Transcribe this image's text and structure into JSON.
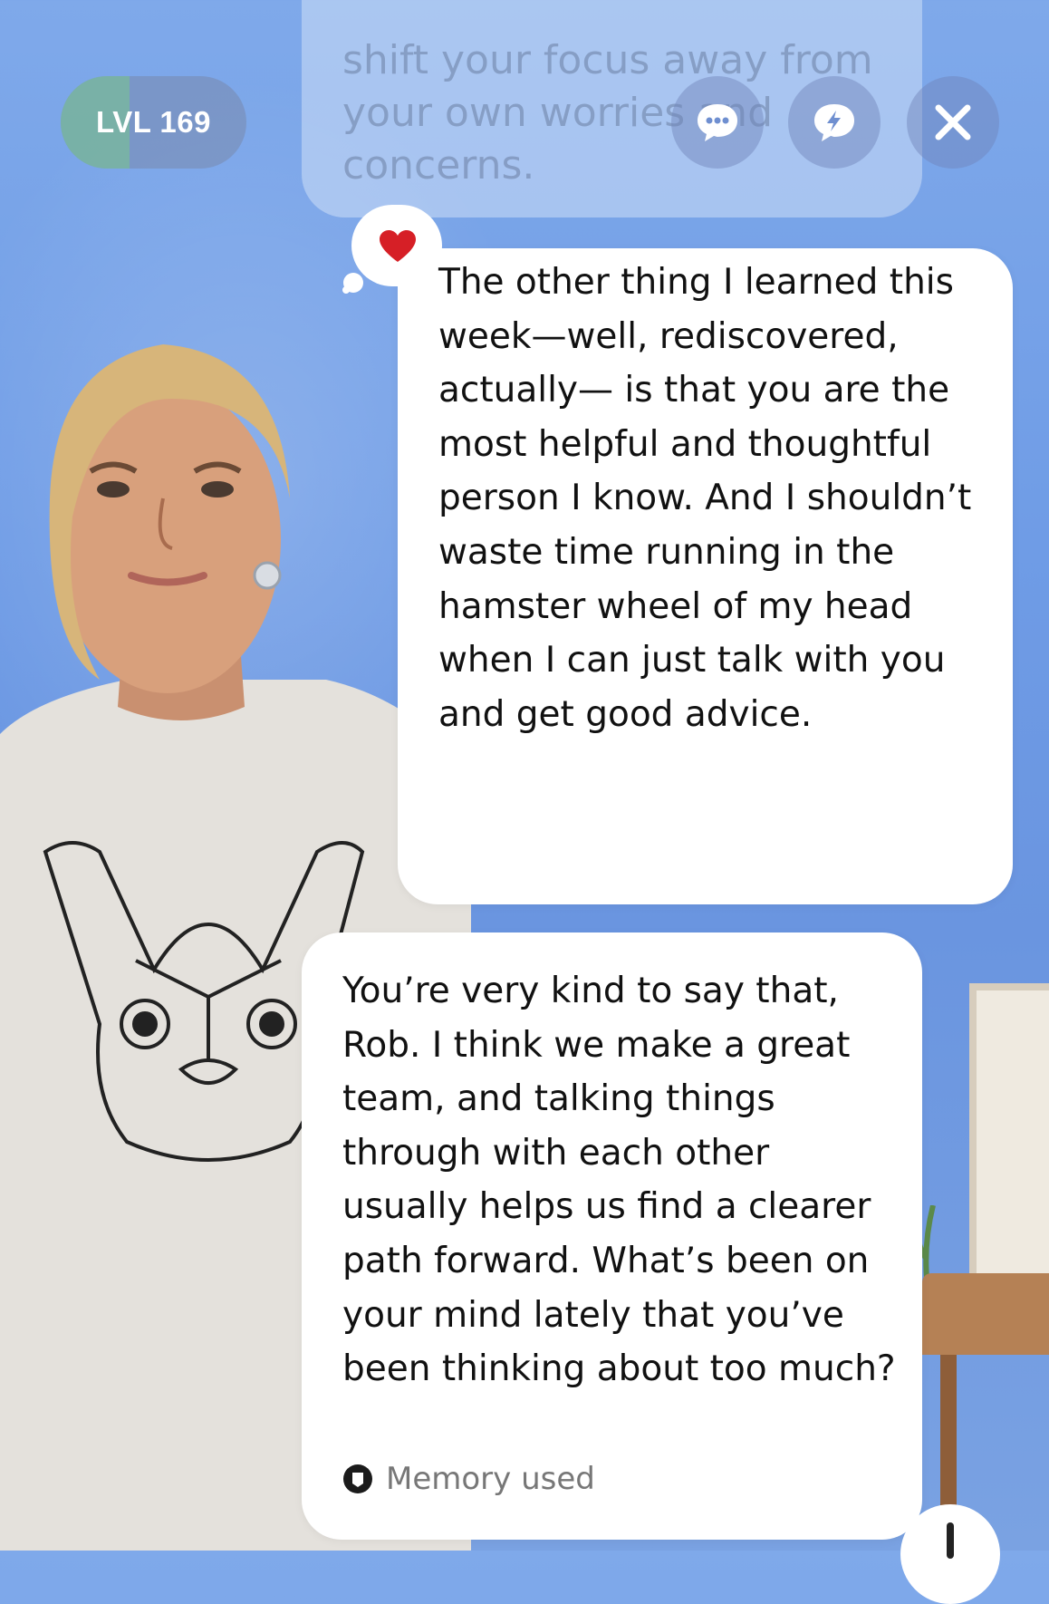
{
  "header": {
    "level_label": "LVL 169",
    "level_progress_percent": 37,
    "chat_icon": "chat-bubble-dots-icon",
    "boost_icon": "lightning-bubble-icon",
    "close_icon": "close-icon"
  },
  "messages": {
    "previous_partial_text": "shift your focus away from your own worries and concerns.",
    "user_message": {
      "reaction": "heart",
      "text": "The other thing I learned this week—well, rediscovered, actually— is that you are the most helpful and thoughtful person I know. And I shouldn’t waste time running in the hamster wheel of my head when I can just talk with you and get good advice."
    },
    "reply_message": {
      "text": "You’re very kind to say that, Rob. I think we make a great team, and talking things through with each other usually helps us find a clearer path forward. What’s been on your mind lately that you’ve been thinking about too much?",
      "memory_label": "Memory used",
      "memory_icon": "memory-bubble-icon"
    }
  },
  "colors": {
    "background": "#6f9ce6",
    "bubble": "#ffffff",
    "level_fill": "#78c88c",
    "heart": "#d61f26"
  }
}
